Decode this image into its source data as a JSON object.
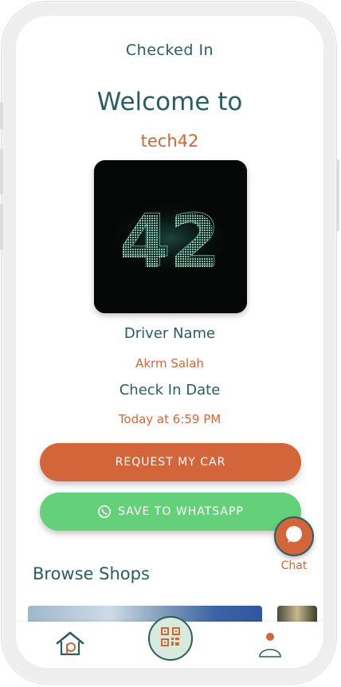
{
  "header": {
    "status": "Checked In"
  },
  "welcome": {
    "title": "Welcome to",
    "venue": "tech42"
  },
  "logo": {
    "text": "42",
    "icon": "tech42-logo"
  },
  "details": {
    "driver_label": "Driver Name",
    "driver_value": "Akrm Salah",
    "date_label": "Check In Date",
    "date_value": "Today at 6:59 PM"
  },
  "actions": {
    "request_label": "REQUEST MY CAR",
    "whatsapp_label": "SAVE TO WHATSAPP",
    "whatsapp_icon": "whatsapp-icon"
  },
  "chat": {
    "label": "Chat",
    "icon": "chat-bubble-icon"
  },
  "browse": {
    "title": "Browse Shops"
  },
  "nav": {
    "items": [
      "home-icon",
      "qr-code-icon",
      "profile-icon"
    ]
  },
  "colors": {
    "primary": "#2a5d5d",
    "accent": "#d2663a",
    "whatsapp": "#64d07a"
  }
}
